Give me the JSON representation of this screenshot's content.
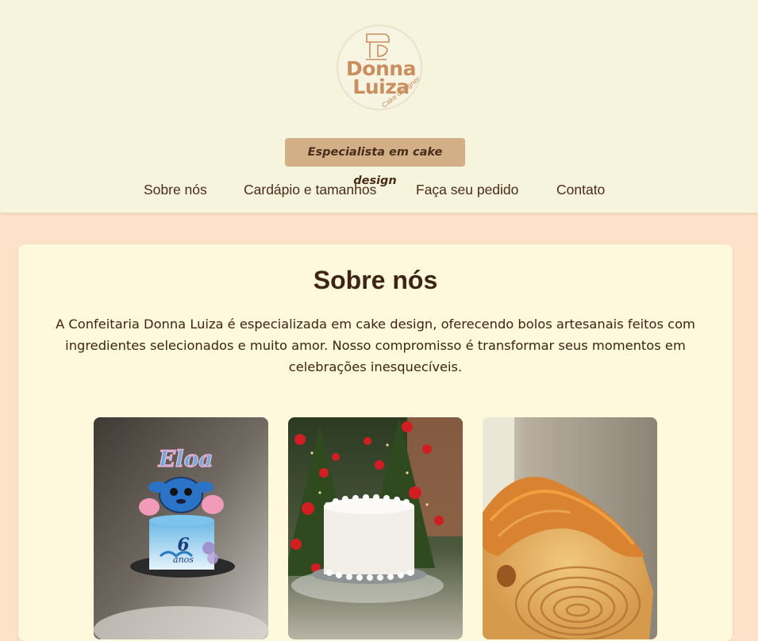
{
  "brand": {
    "name_line1": "Donna",
    "name_line2": "Luiza",
    "tagline": "Cake designer",
    "primary_color": "#c98f5e"
  },
  "header": {
    "badge": "Especialista em cake design",
    "nav": [
      {
        "label": "Sobre nós"
      },
      {
        "label": "Cardápio e tamanhos"
      },
      {
        "label": "Faça seu pedido"
      },
      {
        "label": "Contato"
      }
    ]
  },
  "about": {
    "title": "Sobre nós",
    "text": "A Confeitaria Donna Luiza é especializada em cake design, oferecendo bolos artesanais feitos com ingredientes selecionados e muito amor. Nosso compromisso é transformar seus momentos em celebrações inesquecíveis.",
    "photos": [
      {
        "icon": "stitch-birthday-cake-photo",
        "topper_name": "Eloa",
        "topper_age_number": "6",
        "topper_age_word": "anos"
      },
      {
        "icon": "white-cake-christmas-photo"
      },
      {
        "icon": "caramel-roll-cake-photo"
      }
    ]
  },
  "colors": {
    "header_bg": "#f6f4dd",
    "page_bg": "#fde1c8",
    "card_bg": "#fef8dc",
    "badge_bg": "#d2af87",
    "text": "#4a2c1a"
  }
}
